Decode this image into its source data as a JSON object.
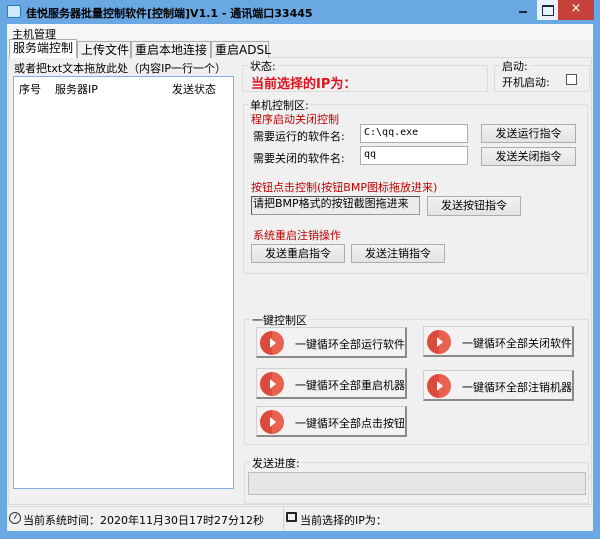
{
  "window": {
    "title": "佳悦服务器批量控制软件[控制端]V1.1 - 通讯端口33445",
    "close": "×"
  },
  "menu": {
    "items": [
      "主机管理"
    ]
  },
  "tabs": [
    "服务端控制",
    "上传文件",
    "重启本地连接",
    "重启ADSL"
  ],
  "left": {
    "hint": "或者把txt文本拖放此处（内容IP一行一个）",
    "columns": [
      "序号",
      "服务器IP",
      "发送状态"
    ]
  },
  "status_group": {
    "label": "状态:",
    "current_ip": "当前选择的IP为："
  },
  "startup_group": {
    "label": "启动:",
    "autostart_label": "开机启动:",
    "autostart_checked": false
  },
  "single": {
    "label": "单机控制区:",
    "program_section": "程序启动关闭控制",
    "run_label": "需要运行的软件名:",
    "run_value": "C:\\qq.exe",
    "close_label": "需要关闭的软件名:",
    "close_value": "qq",
    "send_run": "发送运行指令",
    "send_close": "发送关闭指令",
    "button_section": "按钮点击控制(按钮BMP图标拖放进来)",
    "bmp_placeholder": "请把BMP格式的按钮截图拖进来",
    "send_button": "发送按钮指令",
    "system_section": "系统重启注销操作",
    "send_restart": "发送重启指令",
    "send_logout": "发送注销指令"
  },
  "onekey": {
    "label": "一键控制区",
    "buttons": [
      "一键循环全部运行软件",
      "一键循环全部关闭软件",
      "一键循环全部重启机器",
      "一键循环全部注销机器",
      "一键循环全部点击按钮"
    ]
  },
  "progress": {
    "label": "发送进度:",
    "value": 0
  },
  "statusbar": {
    "time": "当前系统时间：2020年11月30日17时27分12秒",
    "ip": "当前选择的IP为："
  }
}
